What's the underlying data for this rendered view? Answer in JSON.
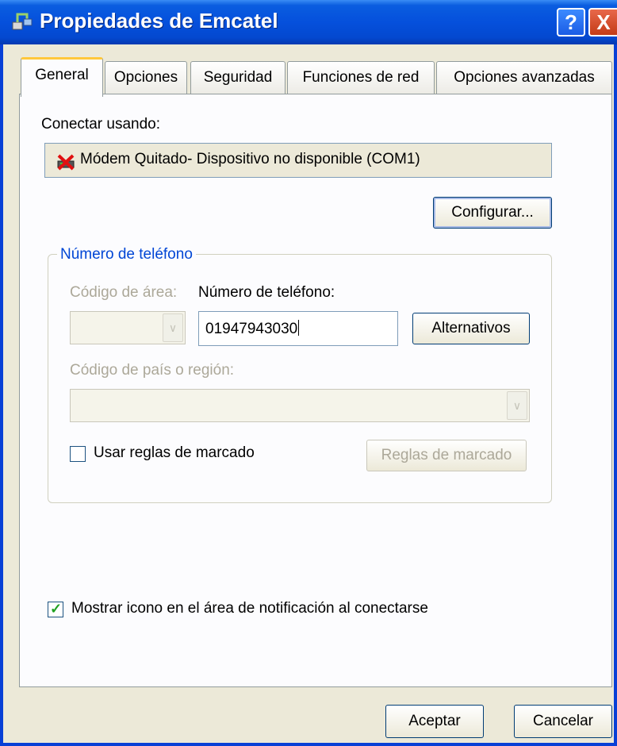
{
  "window": {
    "title": "Propiedades de Emcatel",
    "help_button": "?",
    "close_button": "X"
  },
  "tabs": [
    {
      "label": "General",
      "active": true
    },
    {
      "label": "Opciones",
      "active": false
    },
    {
      "label": "Seguridad",
      "active": false
    },
    {
      "label": "Funciones de red",
      "active": false
    },
    {
      "label": "Opciones avanzadas",
      "active": false
    }
  ],
  "general": {
    "connect_label": "Conectar usando:",
    "device": {
      "name": "Módem Quitado- Dispositivo no disponible (COM1)",
      "icon": "modem-unavailable-icon"
    },
    "configure_button": "Configurar...",
    "phone_group": {
      "legend": "Número de teléfono",
      "area_code_label": "Código de área:",
      "area_code_value": "",
      "phone_label": "Número de teléfono:",
      "phone_value": "01947943030",
      "alternates_button": "Alternativos",
      "country_label": "Código de país o región:",
      "country_value": "",
      "use_dialing_rules_label": "Usar reglas de marcado",
      "use_dialing_rules_checked": false,
      "dialing_rules_button": "Reglas de marcado"
    },
    "show_icon_label": "Mostrar icono en el área de notificación al conectarse",
    "show_icon_checked": true
  },
  "footer": {
    "ok_button": "Aceptar",
    "cancel_button": "Cancelar"
  },
  "colors": {
    "titlebar": "#0550dc",
    "window_face": "#ece9d8",
    "group_legend": "#0046d5",
    "disabled_text": "#aca899",
    "active_tab_accent": "#ffc83c"
  }
}
